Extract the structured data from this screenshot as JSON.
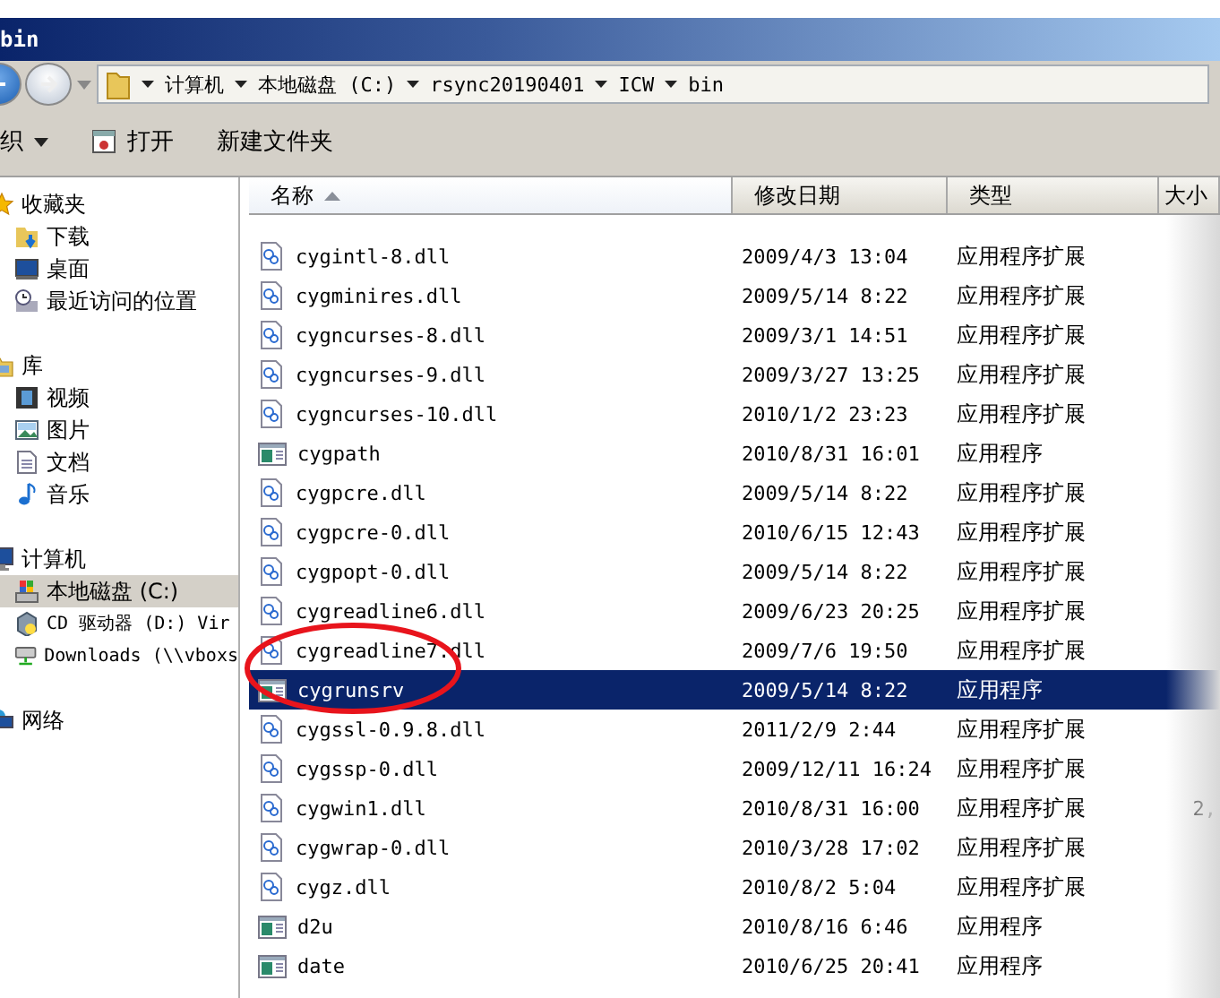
{
  "window": {
    "title": "bin"
  },
  "address": {
    "crumbs": [
      "计算机",
      "本地磁盘 (C:)",
      "rsync20190401",
      "ICW",
      "bin"
    ]
  },
  "toolbar": {
    "items": [
      {
        "label": "织",
        "kind": "menu"
      },
      {
        "label": "打开",
        "kind": "open"
      },
      {
        "label": "新建文件夹",
        "kind": "plain"
      }
    ]
  },
  "sidebar": {
    "groups": [
      {
        "label": "收藏夹",
        "kind": "star",
        "selected": false,
        "children": [
          {
            "label": "下载",
            "kind": "download",
            "selected": false
          },
          {
            "label": "桌面",
            "kind": "desktop",
            "selected": false
          },
          {
            "label": "最近访问的位置",
            "kind": "recent",
            "selected": false
          }
        ]
      },
      {
        "label": "库",
        "kind": "library",
        "selected": false,
        "children": [
          {
            "label": "视频",
            "kind": "video",
            "selected": false
          },
          {
            "label": "图片",
            "kind": "image",
            "selected": false
          },
          {
            "label": "文档",
            "kind": "document",
            "selected": false
          },
          {
            "label": "音乐",
            "kind": "music",
            "selected": false
          }
        ]
      },
      {
        "label": "计算机",
        "kind": "computer",
        "selected": false,
        "children": [
          {
            "label": "本地磁盘 (C:)",
            "kind": "drive",
            "selected": true
          },
          {
            "label": "CD 驱动器 (D:) Vir",
            "kind": "cd",
            "selected": false
          },
          {
            "label": "Downloads (\\\\vboxs",
            "kind": "share",
            "selected": false
          }
        ]
      },
      {
        "label": "网络",
        "kind": "network",
        "selected": false
      }
    ]
  },
  "table": {
    "columns": [
      {
        "label": "名称",
        "sorted": true
      },
      {
        "label": "修改日期",
        "sorted": false
      },
      {
        "label": "类型",
        "sorted": false
      },
      {
        "label": "大小",
        "sorted": false
      }
    ],
    "rows": [
      {
        "name": "cygintl-8.dll",
        "date": "2009/4/3 13:04",
        "type": "应用程序扩展",
        "kind": "dll",
        "selected": false
      },
      {
        "name": "cygminires.dll",
        "date": "2009/5/14 8:22",
        "type": "应用程序扩展",
        "kind": "dll",
        "selected": false
      },
      {
        "name": "cygncurses-8.dll",
        "date": "2009/3/1 14:51",
        "type": "应用程序扩展",
        "kind": "dll",
        "selected": false
      },
      {
        "name": "cygncurses-9.dll",
        "date": "2009/3/27 13:25",
        "type": "应用程序扩展",
        "kind": "dll",
        "selected": false
      },
      {
        "name": "cygncurses-10.dll",
        "date": "2010/1/2 23:23",
        "type": "应用程序扩展",
        "kind": "dll",
        "selected": false
      },
      {
        "name": "cygpath",
        "date": "2010/8/31 16:01",
        "type": "应用程序",
        "kind": "exe",
        "selected": false
      },
      {
        "name": "cygpcre.dll",
        "date": "2009/5/14 8:22",
        "type": "应用程序扩展",
        "kind": "dll",
        "selected": false
      },
      {
        "name": "cygpcre-0.dll",
        "date": "2010/6/15 12:43",
        "type": "应用程序扩展",
        "kind": "dll",
        "selected": false
      },
      {
        "name": "cygpopt-0.dll",
        "date": "2009/5/14 8:22",
        "type": "应用程序扩展",
        "kind": "dll",
        "selected": false
      },
      {
        "name": "cygreadline6.dll",
        "date": "2009/6/23 20:25",
        "type": "应用程序扩展",
        "kind": "dll",
        "selected": false
      },
      {
        "name": "cygreadline7.dll",
        "date": "2009/7/6 19:50",
        "type": "应用程序扩展",
        "kind": "dll",
        "selected": false
      },
      {
        "name": "cygrunsrv",
        "date": "2009/5/14 8:22",
        "type": "应用程序",
        "kind": "exe",
        "selected": true
      },
      {
        "name": "cygssl-0.9.8.dll",
        "date": "2011/2/9 2:44",
        "type": "应用程序扩展",
        "kind": "dll",
        "selected": false
      },
      {
        "name": "cygssp-0.dll",
        "date": "2009/12/11 16:24",
        "type": "应用程序扩展",
        "kind": "dll",
        "selected": false
      },
      {
        "name": "cygwin1.dll",
        "date": "2010/8/31 16:00",
        "type": "应用程序扩展",
        "size": "2,",
        "kind": "dll",
        "selected": false
      },
      {
        "name": "cygwrap-0.dll",
        "date": "2010/3/28 17:02",
        "type": "应用程序扩展",
        "kind": "dll",
        "selected": false
      },
      {
        "name": "cygz.dll",
        "date": "2010/8/2 5:04",
        "type": "应用程序扩展",
        "kind": "dll",
        "selected": false
      },
      {
        "name": "d2u",
        "date": "2010/8/16 6:46",
        "type": "应用程序",
        "kind": "exe",
        "selected": false
      },
      {
        "name": "date",
        "date": "2010/6/25 20:41",
        "type": "应用程序",
        "kind": "exe",
        "selected": false
      }
    ]
  },
  "annotation": {
    "kind": "ellipse",
    "color": "#e8141c"
  }
}
